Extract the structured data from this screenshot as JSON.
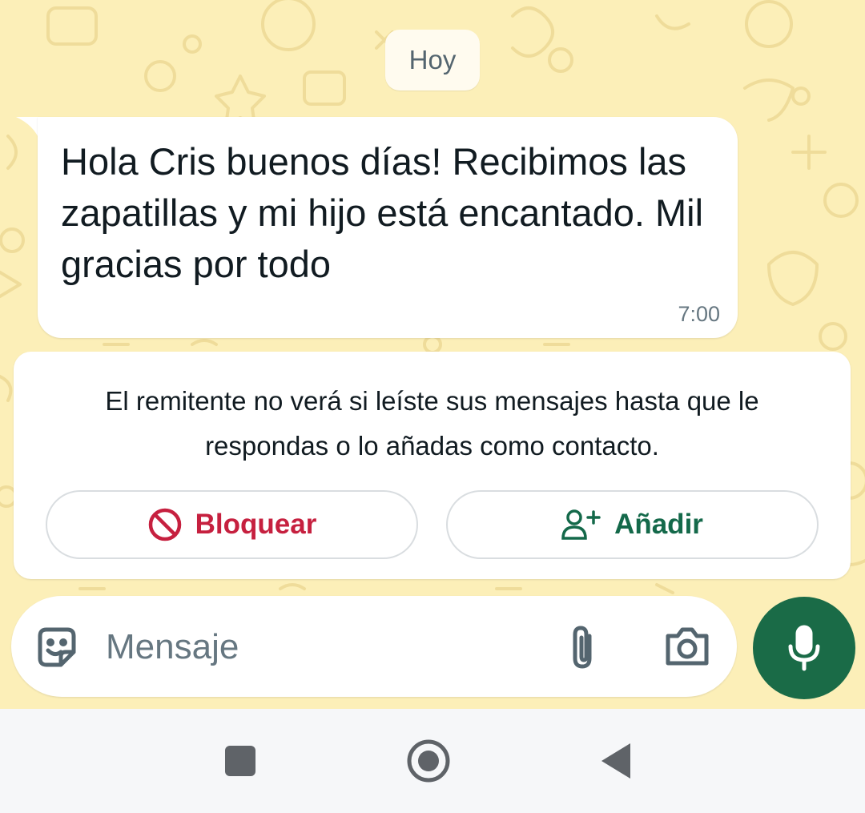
{
  "chat": {
    "date_chip": "Hoy",
    "message": {
      "text": "Hola Cris buenos días! Recibimos las zapatillas y mi hijo está encantado. Mil gracias por todo",
      "time": "7:00"
    }
  },
  "notice": {
    "text": "El remitente no verá si leíste sus mensajes hasta que le respondas o lo añadas como contacto.",
    "block_label": "Bloquear",
    "add_label": "Añadir"
  },
  "composer": {
    "placeholder": "Mensaje",
    "icons": [
      "sticker-icon",
      "paperclip-icon",
      "camera-icon",
      "microphone-icon"
    ]
  },
  "colors": {
    "chat_background": "#fcefb8",
    "block_red": "#c6203f",
    "accent_green": "#1a6b47",
    "add_green": "#14694a"
  },
  "navbar": {
    "icons": [
      "recent-apps-icon",
      "home-icon",
      "back-icon"
    ]
  }
}
